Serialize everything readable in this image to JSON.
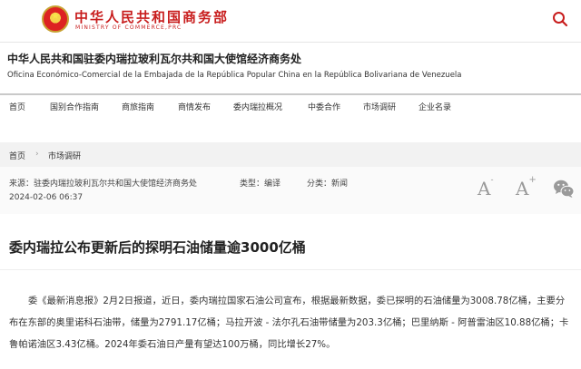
{
  "header": {
    "ministry_cn": "中华人民共和国商务部",
    "ministry_en": "MINISTRY OF COMMERCE,PRC",
    "brand_color": "#c81d1d"
  },
  "embassy": {
    "title_cn": "中华人民共和国驻委内瑞拉玻利瓦尔共和国大使馆经济商务处",
    "title_es": "Oficina Económico-Comercial de la Embajada de la República Popular China en la República Bolivariana de Venezuela"
  },
  "nav": {
    "items": [
      {
        "label": "首页"
      },
      {
        "label": "国别合作指南"
      },
      {
        "label": "商旅指南"
      },
      {
        "label": "商情发布"
      },
      {
        "label": "委内瑞拉概况"
      },
      {
        "label": "中委合作"
      },
      {
        "label": "市场调研"
      },
      {
        "label": "企业名录"
      }
    ]
  },
  "breadcrumb": {
    "home": "首页",
    "separator": "›",
    "current": "市场调研"
  },
  "meta": {
    "source": "来源：驻委内瑞拉玻利瓦尔共和国大使馆经济商务处",
    "type": "类型：编译",
    "category": "分类：新闻",
    "date": "2024-02-06 06:37",
    "font_large": "A",
    "font_small": "A",
    "font_plus": "+",
    "font_minus": "-"
  },
  "article": {
    "title": "委内瑞拉公布更新后的探明石油储量逾3000亿桶",
    "body": "委《最新消息报》2月2日报道，近日，委内瑞拉国家石油公司宣布，根据最新数据，委已探明的石油储量为3008.78亿桶，主要分布在东部的奥里诺科石油带，储量为2791.17亿桶；马拉开波 - 法尔孔石油带储量为203.3亿桶；巴里纳斯 - 阿普雷油区10.88亿桶；卡鲁帕诺油区3.43亿桶。2024年委石油日产量有望达100万桶，同比增长27%。"
  }
}
